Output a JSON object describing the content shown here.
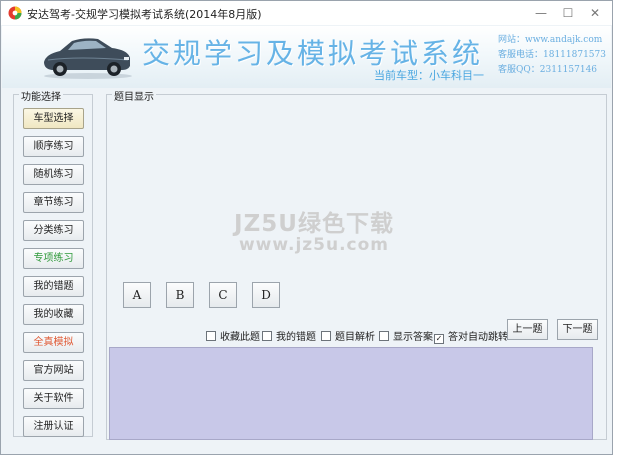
{
  "window": {
    "title": "安达驾考-交规学习模拟考试系统(2014年8月版)",
    "controls": {
      "minimize": "—",
      "maximize": "☐",
      "close": "✕"
    }
  },
  "banner": {
    "app_title": "交规学习及模拟考试系统",
    "current_car": "当前车型：小车科目一",
    "contact": {
      "website": "网站：www.andajk.com",
      "phone": "客服电话：18111871573",
      "qq": "客服QQ：2311157146"
    }
  },
  "sidebar": {
    "label": "功能选择",
    "items": [
      {
        "label": "车型选择",
        "style": "selected"
      },
      {
        "label": "顺序练习",
        "style": "normal"
      },
      {
        "label": "随机练习",
        "style": "normal"
      },
      {
        "label": "章节练习",
        "style": "normal"
      },
      {
        "label": "分类练习",
        "style": "normal"
      },
      {
        "label": "专项练习",
        "style": "green"
      },
      {
        "label": "我的错题",
        "style": "normal"
      },
      {
        "label": "我的收藏",
        "style": "normal"
      },
      {
        "label": "全真模拟",
        "style": "red"
      },
      {
        "label": "官方网站",
        "style": "normal"
      },
      {
        "label": "关于软件",
        "style": "normal"
      },
      {
        "label": "注册认证",
        "style": "normal"
      }
    ]
  },
  "question": {
    "label": "题目显示",
    "answers": [
      "A",
      "B",
      "C",
      "D"
    ],
    "options": [
      {
        "label": "收藏此题",
        "checked": false
      },
      {
        "label": "我的错题",
        "checked": false
      },
      {
        "label": "题目解析",
        "checked": false
      },
      {
        "label": "显示答案",
        "checked": false
      },
      {
        "label": "答对自动跳转",
        "checked": true
      }
    ],
    "prev": "上一题",
    "next": "下一题"
  },
  "watermark": {
    "line1a": "JZ5U",
    "line1b": "绿色下载",
    "line2": "www.jz5u.com"
  },
  "colors": {
    "title_blue": "#66b3e6",
    "answer_area": "#c8c8e8",
    "green_item": "#2f9a3a",
    "red_item": "#e05a35"
  }
}
